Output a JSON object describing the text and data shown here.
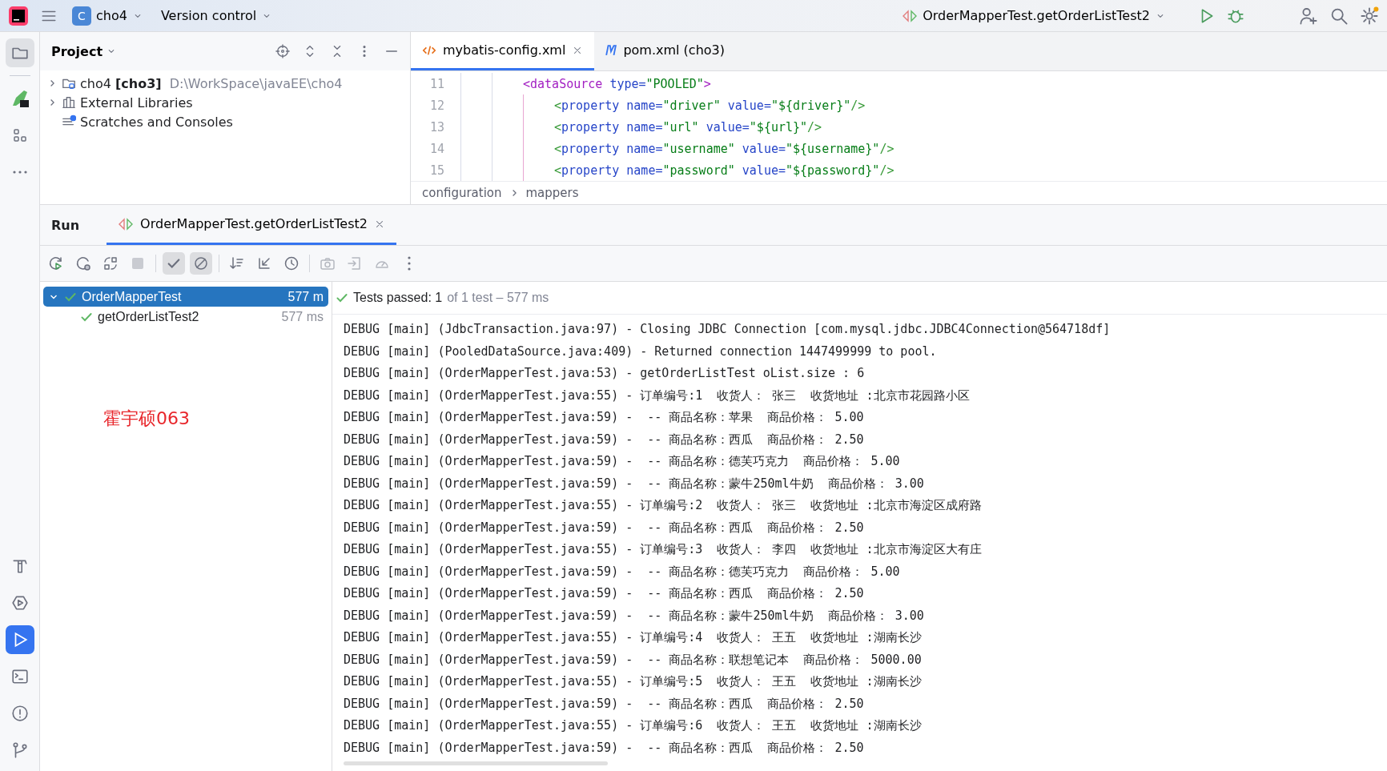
{
  "toolbar": {
    "project_badge": "C",
    "project": "cho4",
    "vcs": "Version control",
    "run_config": "OrderMapperTest.getOrderListTest2"
  },
  "project_panel": {
    "title": "Project",
    "tree": [
      {
        "label": "cho4",
        "module": "[cho3]",
        "path": "D:\\WorkSpace\\javaEE\\cho4",
        "kind": "module",
        "expanded": false
      },
      {
        "label": "External Libraries",
        "kind": "library",
        "expanded": false
      },
      {
        "label": "Scratches and Consoles",
        "kind": "scratch"
      }
    ]
  },
  "editor": {
    "tabs": [
      {
        "label": "mybatis-config.xml",
        "kind": "xml",
        "selected": true
      },
      {
        "label": "pom.xml (cho3)",
        "kind": "maven",
        "selected": false
      }
    ],
    "lines": [
      {
        "number": "11",
        "tokens": [
          {
            "kind": "tag",
            "text": "<dataSource "
          },
          {
            "kind": "attr",
            "text": "type="
          },
          {
            "kind": "value",
            "text": "\"POOLED\""
          },
          {
            "kind": "tag",
            "text": ">"
          }
        ],
        "children": [
          {
            "number": "12",
            "tokens": [
              {
                "kind": "tag2",
                "text": "<"
              },
              {
                "kind": "attr",
                "text": "property name="
              },
              {
                "kind": "value",
                "text": "\"driver\" "
              },
              {
                "kind": "attr",
                "text": "value="
              },
              {
                "kind": "value",
                "text": "\"${driver}\""
              },
              {
                "kind": "tag2",
                "text": "/>"
              }
            ]
          },
          {
            "number": "13",
            "tokens": [
              {
                "kind": "tag2",
                "text": "<"
              },
              {
                "kind": "attr",
                "text": "property name="
              },
              {
                "kind": "value",
                "text": "\"url\" "
              },
              {
                "kind": "attr",
                "text": "value="
              },
              {
                "kind": "value",
                "text": "\"${url}\""
              },
              {
                "kind": "tag2",
                "text": "/>"
              }
            ]
          },
          {
            "number": "14",
            "tokens": [
              {
                "kind": "tag2",
                "text": "<"
              },
              {
                "kind": "attr",
                "text": "property name="
              },
              {
                "kind": "value",
                "text": "\"username\" "
              },
              {
                "kind": "attr",
                "text": "value="
              },
              {
                "kind": "value",
                "text": "\"${username}\""
              },
              {
                "kind": "tag2",
                "text": "/>"
              }
            ]
          },
          {
            "number": "15",
            "tokens": [
              {
                "kind": "tag2",
                "text": "<"
              },
              {
                "kind": "attr",
                "text": "property name="
              },
              {
                "kind": "value",
                "text": "\"password\" "
              },
              {
                "kind": "attr",
                "text": "value="
              },
              {
                "kind": "value",
                "text": "\"${password}\""
              },
              {
                "kind": "tag2",
                "text": "/>"
              }
            ]
          }
        ]
      }
    ],
    "breadcrumbs": [
      "configuration",
      "mappers"
    ]
  },
  "run": {
    "title": "Run",
    "tabs": [
      {
        "label": "OrderMapperTest.getOrderListTest2",
        "selected": true
      }
    ],
    "tests": [
      {
        "label": "OrderMapperTest",
        "time": "577 m",
        "passed": true,
        "selected": true,
        "expanded": true,
        "children": [
          {
            "label": "getOrderListTest2",
            "time": "577 ms",
            "passed": true,
            "selected": false
          }
        ]
      }
    ],
    "note": "霍宇硕063",
    "status": {
      "passed": "Tests passed: 1",
      "summary": "of 1 test – 577 ms"
    },
    "console": [
      "DEBUG [main] (JdbcTransaction.java:97) - Closing JDBC Connection [com.mysql.jdbc.JDBC4Connection@564718df]",
      "DEBUG [main] (PooledDataSource.java:409) - Returned connection 1447499999 to pool.",
      "DEBUG [main] (OrderMapperTest.java:53) - getOrderListTest oList.size : 6",
      "DEBUG [main] (OrderMapperTest.java:55) - 订单编号:1  收货人： 张三  收货地址 :北京市花园路小区",
      "DEBUG [main] (OrderMapperTest.java:59) -  -- 商品名称：苹果  商品价格： 5.00",
      "DEBUG [main] (OrderMapperTest.java:59) -  -- 商品名称：西瓜  商品价格： 2.50",
      "DEBUG [main] (OrderMapperTest.java:59) -  -- 商品名称：德芙巧克力  商品价格： 5.00",
      "DEBUG [main] (OrderMapperTest.java:59) -  -- 商品名称：蒙牛250ml牛奶  商品价格： 3.00",
      "DEBUG [main] (OrderMapperTest.java:55) - 订单编号:2  收货人： 张三  收货地址 :北京市海淀区成府路",
      "DEBUG [main] (OrderMapperTest.java:59) -  -- 商品名称：西瓜  商品价格： 2.50",
      "DEBUG [main] (OrderMapperTest.java:55) - 订单编号:3  收货人： 李四  收货地址 :北京市海淀区大有庄",
      "DEBUG [main] (OrderMapperTest.java:59) -  -- 商品名称：德芙巧克力  商品价格： 5.00",
      "DEBUG [main] (OrderMapperTest.java:59) -  -- 商品名称：西瓜  商品价格： 2.50",
      "DEBUG [main] (OrderMapperTest.java:59) -  -- 商品名称：蒙牛250ml牛奶  商品价格： 3.00",
      "DEBUG [main] (OrderMapperTest.java:55) - 订单编号:4  收货人： 王五  收货地址 :湖南长沙",
      "DEBUG [main] (OrderMapperTest.java:59) -  -- 商品名称：联想笔记本  商品价格： 5000.00",
      "DEBUG [main] (OrderMapperTest.java:55) - 订单编号:5  收货人： 王五  收货地址 :湖南长沙",
      "DEBUG [main] (OrderMapperTest.java:59) -  -- 商品名称：西瓜  商品价格： 2.50",
      "DEBUG [main] (OrderMapperTest.java:55) - 订单编号:6  收货人： 王五  收货地址 :湖南长沙",
      "DEBUG [main] (OrderMapperTest.java:59) -  -- 商品名称：西瓜  商品价格： 2.50"
    ]
  }
}
